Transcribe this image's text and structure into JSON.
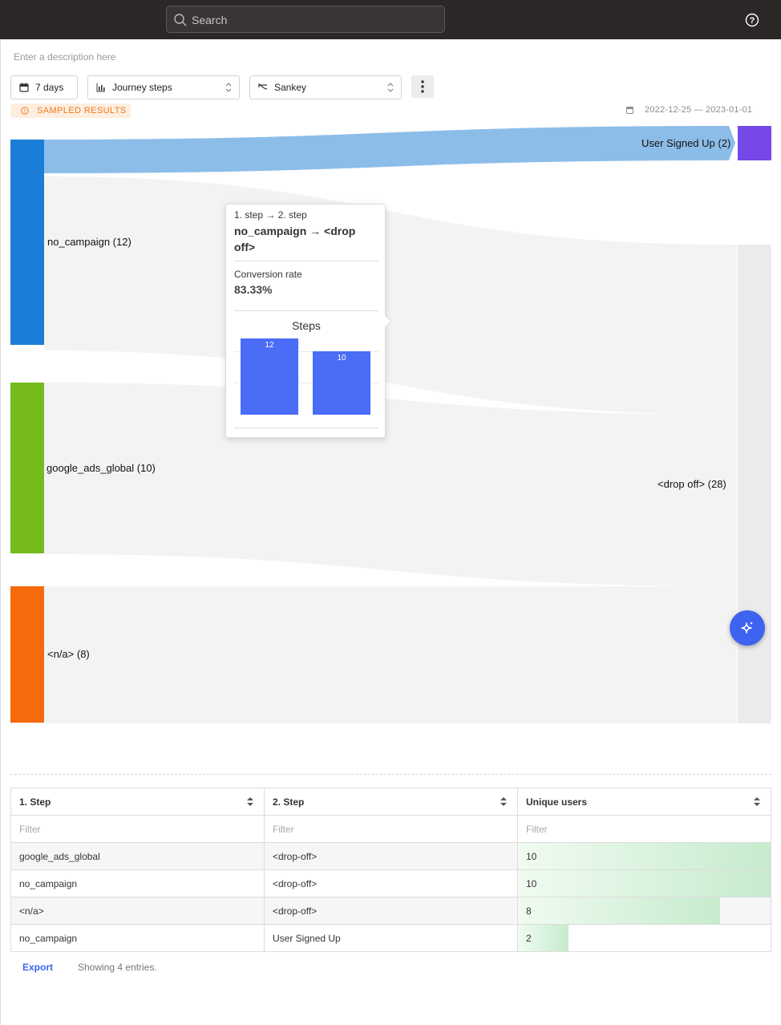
{
  "topbar": {
    "search_placeholder": "Search"
  },
  "description_placeholder": "Enter a description here",
  "controls": {
    "date_range": "7 days",
    "metric": "Journey steps",
    "visualization": "Sankey"
  },
  "sampled_badge": "SAMPLED RESULTS",
  "date_span": "2022-12-25 — 2023-01-01",
  "sankey": {
    "nodes": {
      "no_campaign": "no_campaign (12)",
      "google_ads_global": "google_ads_global (10)",
      "na": "<n/a> (8)",
      "user_signed_up": "User Signed Up (2)",
      "drop_off": "<drop off> (28)"
    },
    "node_colors": {
      "no_campaign": "#1a7ed8",
      "google_ads_global": "#74bb1b",
      "na": "#f56a0a",
      "user_signed_up": "#7648e8",
      "drop_off": "#ebebeb",
      "highlight_link": "#8cbde9"
    }
  },
  "tooltip": {
    "steps": "1. step → 2. step",
    "title": "no_campaign → <drop off>",
    "conversion_label": "Conversion rate",
    "conversion_value": "83.33%",
    "chart_title": "Steps",
    "bars": [
      {
        "value": 12,
        "label": "12"
      },
      {
        "value": 10,
        "label": "10"
      }
    ]
  },
  "table": {
    "headers": [
      "1. Step",
      "2. Step",
      "Unique users"
    ],
    "filter_placeholder": "Filter",
    "rows": [
      {
        "step1": "google_ads_global",
        "step2": "<drop-off>",
        "users": "10",
        "fraction": 1.0
      },
      {
        "step1": "no_campaign",
        "step2": "<drop-off>",
        "users": "10",
        "fraction": 1.0
      },
      {
        "step1": "<n/a>",
        "step2": "<drop-off>",
        "users": "8",
        "fraction": 0.8
      },
      {
        "step1": "no_campaign",
        "step2": "User Signed Up",
        "users": "2",
        "fraction": 0.2
      }
    ]
  },
  "footer": {
    "export": "Export",
    "showing": "Showing 4 entries."
  },
  "icons": [
    "search-icon",
    "help-icon",
    "calendar-icon",
    "bar-chart-icon",
    "sankey-icon",
    "more-vertical-icon",
    "info-icon",
    "sort-icon",
    "sparkle-icon"
  ]
}
